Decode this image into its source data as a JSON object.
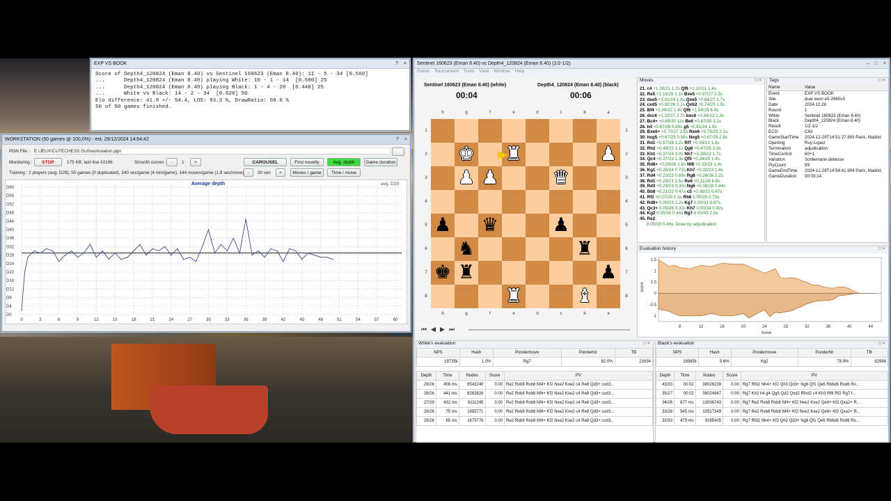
{
  "exp_window": {
    "title": "EXP VS BOOK",
    "controls": [
      "?",
      "×"
    ],
    "lines": [
      "Score of Depth4_120824 (Eman 8.40) vs Sentinel 160623 (Eman 8.40): 11 - 5 - 34 [0.560]",
      "...      Depth4_120824 (Eman 8.40) playing White: 10 - 1 - 14  [0.680] 25",
      "...      Depth4_120824 (Eman 8.40) playing Black: 1 - 4 - 20  [0.440] 25",
      "...      White vs Black: 14 - 2 - 34  [0.620] 50",
      "Elo difference: 41.9 +/- 54.4, LOS: 93.3 %, DrawRatio: 68.0 %",
      "50 of 50 games finished."
    ]
  },
  "workstation": {
    "title": "WORKSTATION (50 games @ 100,0%) - est. 29/12/2024 14:54:42",
    "controls": [
      "?",
      "×"
    ],
    "pgn_label": "PGN File :",
    "pgn_value": "E:\\JEUX\\CUTECHESS GUI\\workstation.pgn",
    "monitoring_label": "Monitoring :",
    "stop": "STOP",
    "kb": "175 KB, last line #3196",
    "smooth_label": "Smooth curves :",
    "smooth_minus": "-",
    "smooth_val": "1",
    "smooth_plus": "+",
    "carousel": "CAROUSEL",
    "first_novelty": "First novelty",
    "avg_depth": "Avg. depth",
    "game_duration": "Game duration",
    "training": "Training : 2 players (avg. D29), 50 games (0 duplicated), 240 sec/game (4 min/game), 144 moves/game (1,9 sec/move)",
    "sec_minus": "-",
    "sec_val": "30 sec",
    "sec_plus": "+",
    "moves_game": "Moves / game",
    "time_move": "Time / move"
  },
  "chart_data": {
    "type": "line",
    "title": "Average depth",
    "annotation": "avg. D29",
    "yticks": [
      "D60",
      "D56",
      "D52",
      "D48",
      "D44",
      "D40",
      "D36",
      "D32",
      "D28",
      "D24",
      "D20",
      "D16",
      "D12",
      "D8",
      "D4",
      "D0"
    ],
    "xticks": [
      "0",
      "3",
      "6",
      "9",
      "12",
      "15",
      "18",
      "21",
      "24",
      "27",
      "30",
      "33",
      "36",
      "39",
      "42",
      "45",
      "48",
      "51",
      "54",
      "57",
      "60"
    ],
    "xlim": [
      0,
      61
    ],
    "ylim": [
      0,
      61
    ],
    "avg_line": 29,
    "x": [
      0,
      0.5,
      1,
      2,
      3,
      4,
      5,
      6,
      7,
      8,
      9,
      10,
      11,
      12,
      13,
      14,
      15,
      16,
      17,
      18,
      19,
      20,
      21,
      22,
      23,
      24,
      25,
      26,
      27,
      28,
      29,
      30,
      31,
      32,
      33,
      34,
      35,
      36,
      37,
      38,
      39,
      40,
      41,
      42,
      43,
      44,
      45,
      46,
      47,
      48,
      49,
      50
    ],
    "values": [
      2,
      20,
      27,
      30,
      29,
      31,
      30,
      25,
      28,
      30,
      27,
      29,
      33,
      27,
      30,
      26,
      29,
      26,
      27,
      30,
      33,
      28,
      31,
      30,
      32,
      28,
      31,
      26,
      27,
      25,
      32,
      40,
      29,
      33,
      30,
      36,
      29,
      45,
      28,
      30,
      27,
      31,
      30,
      25,
      31,
      30,
      26,
      29,
      28,
      27,
      27,
      26
    ]
  },
  "game": {
    "title": "Sentinel 160623 (Eman 8.40) vs Depth4_120824 (Eman 8.40) (1/2-1/2)",
    "controls": [
      "–",
      "□",
      "×"
    ],
    "menu": [
      "Game",
      "Tournament",
      "Tools",
      "View",
      "Window",
      "Help"
    ],
    "white_name": "Sentinel 160623 (Eman 8.40) (white)",
    "white_clock": "00:04",
    "black_name": "Depth4_120824 (Eman 8.40) (black)",
    "black_clock": "00:06",
    "files": [
      "h",
      "g",
      "f",
      "e",
      "d",
      "c",
      "b",
      "a"
    ],
    "ranks": [
      "1",
      "2",
      "3",
      "4",
      "5",
      "6",
      "7",
      "8"
    ],
    "board": [
      "",
      "",
      "",
      "",
      "",
      "",
      "",
      "",
      "",
      "wK",
      "",
      "wR",
      "",
      "",
      "",
      "wP",
      "",
      "wP",
      "wP",
      "",
      "",
      "wQ",
      "",
      "",
      "",
      "",
      "",
      "",
      "",
      "",
      "",
      "",
      "bP",
      "",
      "bQ",
      "",
      "",
      "bP",
      "",
      "",
      "",
      "bN",
      "",
      "",
      "",
      "",
      "bR",
      "",
      "bK",
      "bR",
      "",
      "",
      "",
      "",
      "",
      "bP",
      "",
      "",
      "",
      "wR",
      "",
      "",
      "wB",
      ""
    ]
  },
  "moves": {
    "title": "Moves",
    "rows": [
      [
        "21.",
        "c4",
        "+1.30/21 1.2s",
        "Qf6",
        "+1.10/21 1.4s"
      ],
      [
        "22.",
        "Re5",
        "+1.16/25 2.1s",
        "Bxe5",
        "+0.97/27 2.5s"
      ],
      [
        "23.",
        "dxe5",
        "+1.01/24 1.6s",
        "Qxe5",
        "+0.84/27 1.7s"
      ],
      [
        "24.",
        "cxd5",
        "+0.92/26 2.1s",
        "Qxb2",
        "+0.74/25 1.5s"
      ],
      [
        "25.",
        "Bf4",
        "+1.00/22 1.4s",
        "Qf6",
        "+1.04/26 6.4s"
      ],
      [
        "26.",
        "dxc6",
        "+1.10/27 2.7s",
        "bxc6",
        "+0.84/22 1.3s"
      ],
      [
        "27.",
        "Bc4+",
        "+0.69/30 11s",
        "Be6",
        "+0.87/25 2.1s"
      ],
      [
        "28.",
        "h4",
        "+0.67/26 0.69s",
        "g5",
        "+0.81/24 1.8s"
      ],
      [
        "29.",
        "Bxe6+",
        "+0.70/27 3.5s",
        "Rxe6",
        "+0.78/25 2.1s"
      ],
      [
        "30.",
        "hxg5",
        "+0.67/25 0.56s",
        "Nxg5",
        "+0.67/25 2.6s"
      ],
      [
        "31.",
        "Rd1",
        "+0.57/26 1.2s",
        "Rf7",
        "+0.58/23 1.8s"
      ],
      [
        "32.",
        "Rh2",
        "+0.49/22 1.1s",
        "Qg6",
        "+0.47/25 2.3s"
      ],
      [
        "33.",
        "Kh1",
        "+0.37/24 3.0s",
        "Nh7",
        "+0.39/23 1.7s"
      ],
      [
        "34.",
        "Qc4",
        "+0.37/23 1.3s",
        "Qf5",
        "+0.34/25 1.6s"
      ],
      [
        "35.",
        "Rd8+",
        "+0.29/26 1.6s",
        "Nf8",
        "+0.32/23 1.4s"
      ],
      [
        "36.",
        "Kg1",
        "+0.25/24 0.72s",
        "Kh7",
        "+0.32/23 1.4s"
      ],
      [
        "37.",
        "Rd4",
        "+0.23/23 0.69s",
        "Rg8",
        "+0.26/26 2.2s"
      ],
      [
        "38.",
        "Rd1",
        "+0.29/21 1.5s",
        "Re6",
        "+0.11/28 6.8s"
      ],
      [
        "39.",
        "Rd3",
        "+0.29/19 0.30s",
        "Ng6",
        "+0.08/28 0.44s"
      ],
      [
        "40.",
        "Bb8",
        "+0.21/22 0.47s",
        "c5",
        "+0.05/21 0.67s"
      ],
      [
        "41.",
        "Rf2",
        "+0.07/20 1.3s",
        "Rb6",
        "0.00/26 0.73s"
      ],
      [
        "42.",
        "Rd8+",
        "0.00/23 1.2s",
        "Kg7",
        "0.00/31 0.87s"
      ],
      [
        "43.",
        "Qc3+",
        "0.00/26 0.33s",
        "Kh7",
        "0.00/34 0.92s"
      ],
      [
        "44.",
        "Kg2",
        "0.00/30 0.44s",
        "Rg7",
        "0.00/43 2.0s"
      ],
      [
        "45.",
        "Re2",
        "",
        "",
        ""
      ]
    ],
    "result": "0.00/29 0.46s, Draw by adjudication"
  },
  "tags": {
    "title": "Tags",
    "head": [
      "Name",
      "Value"
    ],
    "rows": [
      [
        "Event",
        "EXP VS BOOK"
      ],
      [
        "Site",
        "dual xeon e5-2660v3"
      ],
      [
        "Date",
        "2024.12.29"
      ],
      [
        "Round",
        "1"
      ],
      [
        "White",
        "Sentinel 160623 (Eman 8.40)"
      ],
      [
        "Black",
        "Depth4_120824 (Eman 8.40)"
      ],
      [
        "Result",
        "1/2-1/2"
      ],
      [
        "ECO",
        "C63"
      ],
      [
        "GameStartTime",
        "2024-12-29T14:51:27.893 Paris, Madrid"
      ],
      [
        "Opening",
        "Ruy Lopez"
      ],
      [
        "Termination",
        "adjudication"
      ],
      [
        "TimeControl",
        "60+1"
      ],
      [
        "Variation",
        "Schliemann defense"
      ],
      [
        "PlyCount",
        "89"
      ],
      [
        "GameEndTime",
        "2024-12-29T14:54:41.904 Paris, Madrid"
      ],
      [
        "GameDuration",
        "00:03:14"
      ]
    ]
  },
  "eval_history": {
    "title": "Evaluation history",
    "xlabel": "move",
    "ylabel": "score",
    "yticks": [
      "1.5",
      "1",
      "0.5",
      "0",
      "-0.5",
      "-1"
    ],
    "xticks": [
      "8",
      "12",
      "16",
      "20",
      "24",
      "28",
      "32",
      "36",
      "40",
      "44"
    ],
    "moves": [
      4,
      6,
      7,
      8,
      10,
      12,
      14,
      16,
      18,
      20,
      21,
      22,
      23,
      24,
      25,
      26,
      27,
      28,
      29,
      30,
      31,
      32,
      33,
      34,
      35,
      36,
      37,
      38,
      39,
      40,
      41,
      42,
      43,
      44,
      45
    ],
    "scores": [
      1.5,
      1.2,
      1.25,
      1.15,
      1.1,
      1.25,
      1.2,
      1.35,
      1.3,
      1.3,
      1.2,
      1.1,
      1.0,
      0.9,
      1.0,
      1.1,
      0.7,
      0.67,
      0.7,
      0.67,
      0.57,
      0.49,
      0.37,
      0.37,
      0.29,
      0.25,
      0.23,
      0.29,
      0.29,
      0.21,
      0.07,
      0.0,
      0.0,
      0.0,
      0.0
    ],
    "black_scores": [
      -0.7,
      -0.8,
      -0.9,
      -1.0,
      -1.0,
      -1.0,
      -0.9,
      -1.0,
      -1.0,
      -0.9,
      -1.1,
      -0.97,
      -0.84,
      -0.74,
      -1.04,
      -0.84,
      -0.87,
      -0.81,
      -0.78,
      -0.67,
      -0.58,
      -0.47,
      -0.39,
      -0.34,
      -0.32,
      -0.32,
      -0.26,
      -0.11,
      -0.08,
      -0.05,
      0.0,
      0.0,
      0.0,
      0.0,
      0.0
    ]
  },
  "white_eval": {
    "title": "White's evaluation",
    "stats_head": [
      "NPS",
      "Hash",
      "Pondermove",
      "Ponderhit",
      "TB"
    ],
    "stats": [
      "18735k",
      "1.0%",
      "Rg7",
      "82.0%",
      "21634"
    ],
    "head": [
      "Depth",
      "Time",
      "Nodes",
      "Score",
      "PV"
    ],
    "rows": [
      [
        "29/26",
        "456 ms",
        "8543240",
        "0.00",
        "Re2 Rxb8 Rxb8 Nf4+ Kf2 Nxe2 Kxe2 c4 Re8 Qd3+ cxd3..."
      ],
      [
        "28/26",
        "441 ms",
        "8263826",
        "0.00",
        "Re2 Rxb8 Rxb8 Nf4+ Kf2 Nxe2 Kxe2 c4 Re8 Qd3+ cxd3..."
      ],
      [
        "27/29",
        "432 ms",
        "8111245",
        "0.00",
        "Re2 Rxb8 Rxb8 Nf4+ Kf2 Nxe2 Kxe2 c4 Re8 Qd3+ cxd3..."
      ],
      [
        "26/26",
        "75 ms",
        "1855771",
        "0.00",
        "Re2 Rxb8 Rxb8 Nf4+ Kf2 Nxe2 Kxe2 c4 Re8 Qd3+ cxd3..."
      ],
      [
        "25/26",
        "65 ms",
        "1673776",
        "0.00",
        "Re2 Rxb8 Rxb8 Nf4+ Kf2 Nxe2 Kxe2 c4 Re8 Qd3+ cxd3..."
      ]
    ]
  },
  "black_eval": {
    "title": "Black's evaluation",
    "stats_head": [
      "NPS",
      "Hash",
      "Pondermove",
      "Ponderhit",
      "TB"
    ],
    "stats": [
      "18585k",
      "5.6%",
      "Kg2",
      "78.9%",
      "82994"
    ],
    "head": [
      "Depth",
      "Time",
      "Nodes",
      "Score",
      "PV"
    ],
    "rows": [
      [
        "43/33",
        "00:02",
        "38026239",
        "0.00",
        "Rg7 Rfd2 Nh4+ Kf2 Qh3 Qd3+ Ng6 Qf1 Qe6 Rb6d6 Rxd6 Rx..."
      ],
      [
        "35/27",
        "00:02",
        "38024967",
        "0.00",
        "Rg7 Kh2 h4 g4 Qg5 Qd2 Qxd2 Rfxd2 c4 Kh3 Rf6 Rf2 Rg7 f..."
      ],
      [
        "34/26",
        "677 ms",
        "13036743",
        "0.00",
        "Rg7 Re2 Rxb8 Rxb8 Nf4+ Kf2 Nxe2 Kxe2 Qe6+ Kf2 Qxa2+ R..."
      ],
      [
        "33/26",
        "545 ms",
        "10517349",
        "0.00",
        "Rg7 Re2 Rxb8 Rxb8 Nf4+ Kf2 Nxe2 Kxe2 Qe6+ Kf2 Qxa2+ R..."
      ],
      [
        "32/33",
        "479 ms",
        "9285405",
        "0.00",
        "Rg7 Rfd2 Nh4+ Kf2 Qh2 Qd3+ Ng6 Qf1 Qe6 Rb6d6 Rxd6 Rx..."
      ]
    ]
  }
}
